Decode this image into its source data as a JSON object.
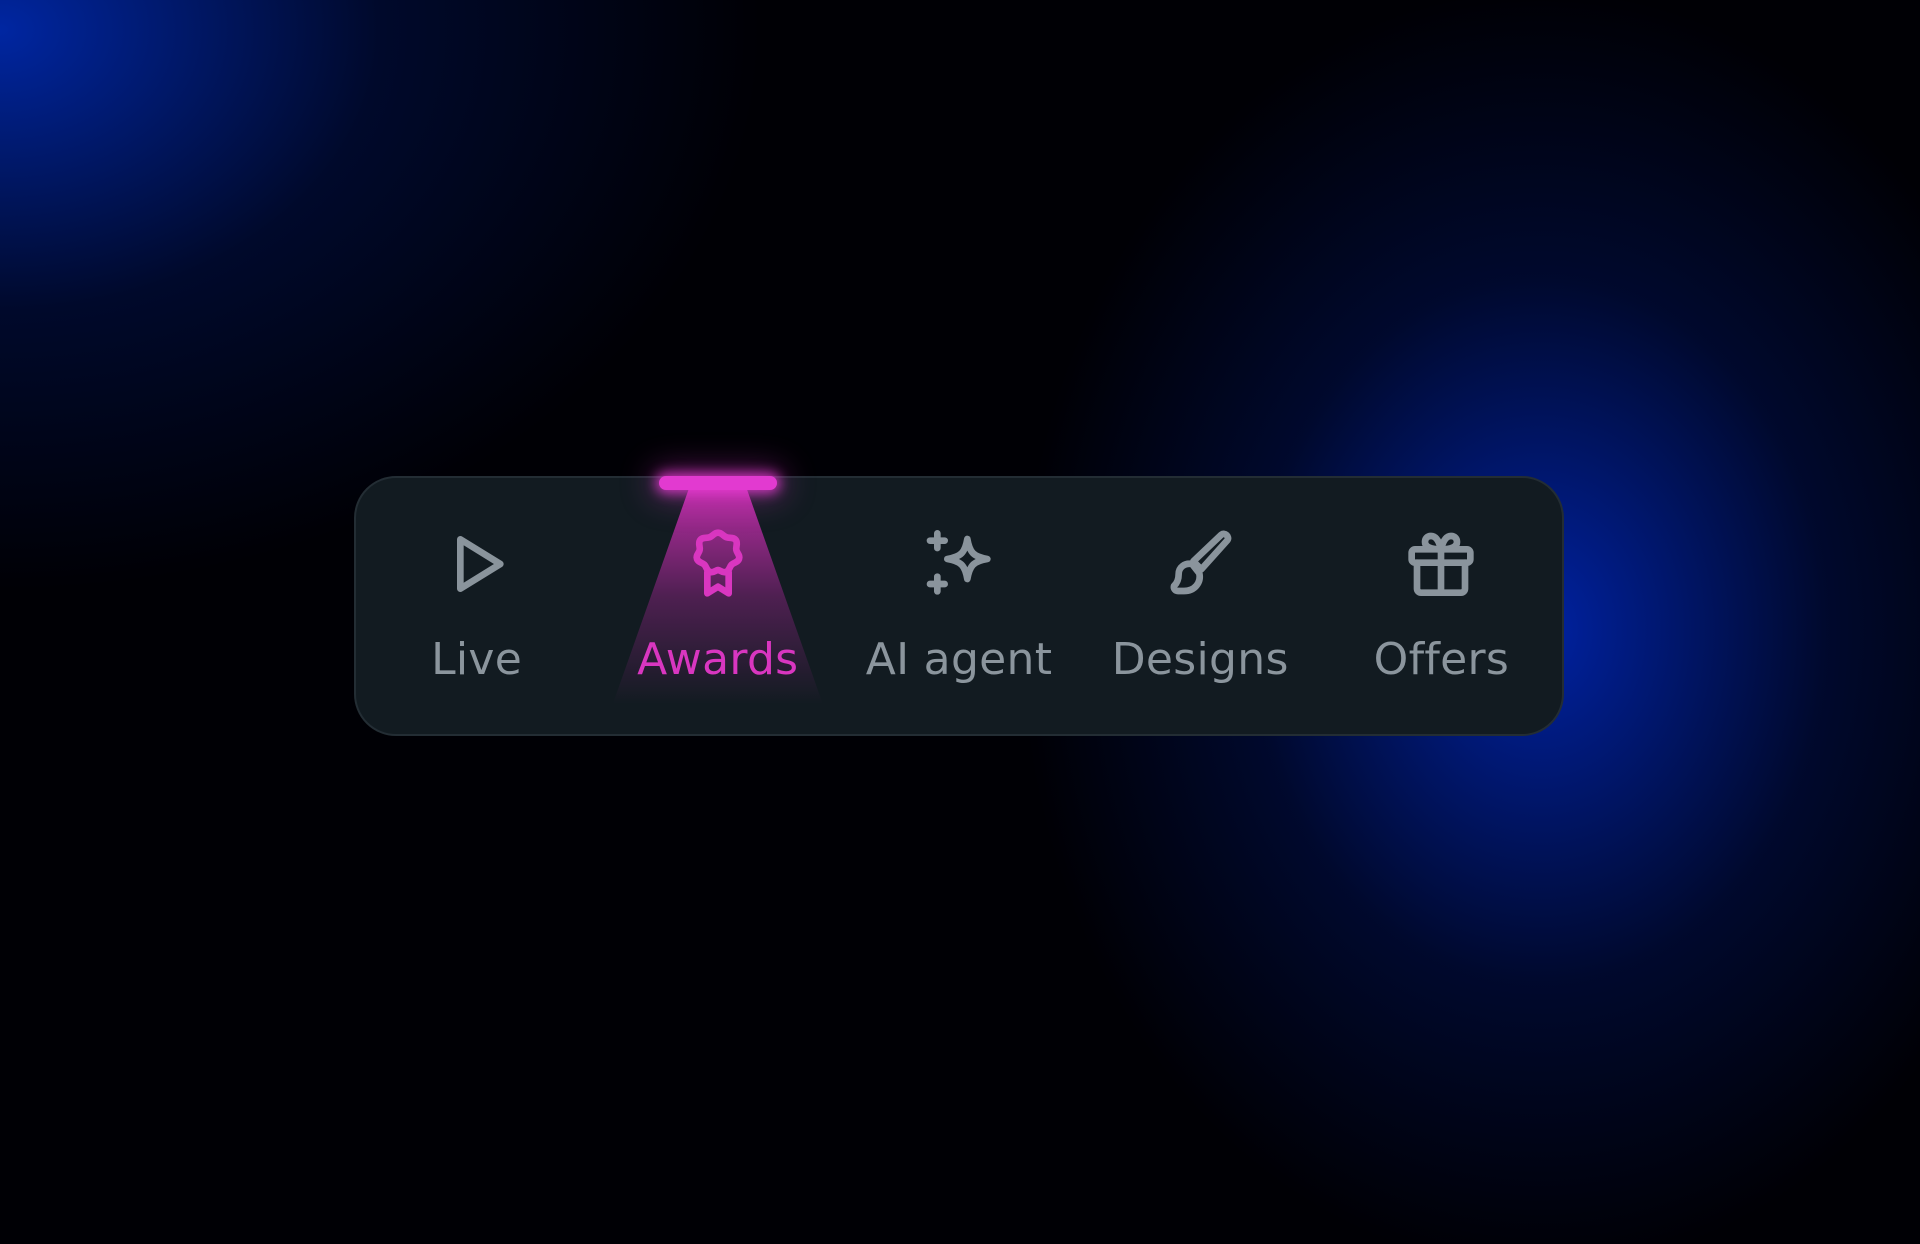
{
  "nav": {
    "active_index": 1,
    "accent_color": "#d936c0",
    "inactive_color": "#8b959d",
    "items": [
      {
        "label": "Live",
        "icon": "play-icon"
      },
      {
        "label": "Awards",
        "icon": "award-ribbon-icon"
      },
      {
        "label": "AI agent",
        "icon": "sparkles-icon"
      },
      {
        "label": "Designs",
        "icon": "paintbrush-icon"
      },
      {
        "label": "Offers",
        "icon": "gift-icon"
      }
    ]
  }
}
